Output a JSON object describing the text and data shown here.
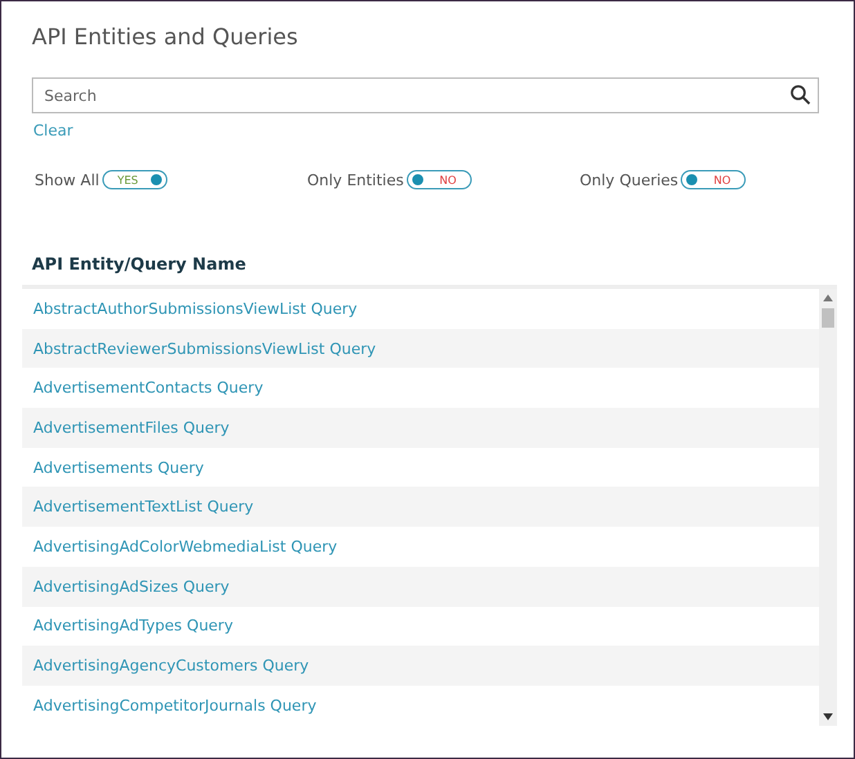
{
  "title": "API Entities and Queries",
  "search": {
    "placeholder": "Search"
  },
  "clear_link": "Clear",
  "toggles": [
    {
      "label": "Show All",
      "on": true,
      "state_text": "YES"
    },
    {
      "label": "Only Entities",
      "on": false,
      "state_text": "NO"
    },
    {
      "label": "Only Queries",
      "on": false,
      "state_text": "NO"
    }
  ],
  "table": {
    "columns": [
      "API Entity/Query Name"
    ],
    "rows": [
      "AbstractAuthorSubmissionsViewList Query",
      "AbstractReviewerSubmissionsViewList Query",
      "AdvertisementContacts Query",
      "AdvertisementFiles Query",
      "Advertisements Query",
      "AdvertisementTextList Query",
      "AdvertisingAdColorWebmediaList Query",
      "AdvertisingAdSizes Query",
      "AdvertisingAdTypes Query",
      "AdvertisingAgencyCustomers Query",
      "AdvertisingCompetitorJournals Query"
    ]
  }
}
